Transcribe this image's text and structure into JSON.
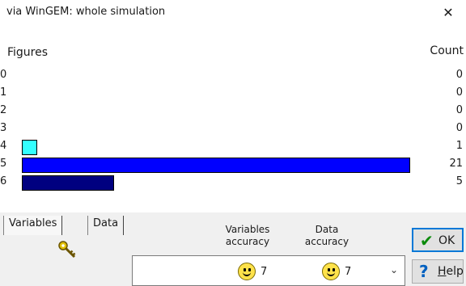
{
  "window": {
    "title": "via WinGEM: whole simulation",
    "close_glyph": "✕"
  },
  "chart_data": {
    "type": "bar",
    "orientation": "horizontal",
    "left_header": "Figures",
    "right_header": "Count",
    "categories": [
      "0",
      "1",
      "2",
      "3",
      "4",
      "5",
      "6"
    ],
    "values": [
      0,
      0,
      0,
      0,
      1,
      21,
      5
    ],
    "bar_colors": [
      "#00ffff",
      "#00ffff",
      "#00ffff",
      "#00ffff",
      "#33ffff",
      "#0000ff",
      "#000080"
    ],
    "xlim": [
      0,
      21
    ]
  },
  "tabs": [
    {
      "label": "Variables",
      "active": true
    },
    {
      "label": "Data",
      "active": false
    }
  ],
  "columns": {
    "variables_accuracy": {
      "line1": "Variables",
      "line2": "accuracy"
    },
    "data_accuracy": {
      "line1": "Data",
      "line2": "accuracy"
    }
  },
  "key_icon": "key-icon",
  "combo": {
    "variables_value": "7",
    "data_value": "7",
    "chevron": "⌄"
  },
  "buttons": {
    "ok": {
      "label": "OK",
      "icon": "✔",
      "icon_color": "#0a8a0a"
    },
    "help": {
      "label_prefix": "H",
      "label_rest": "elp",
      "icon": "?",
      "icon_color": "#0060c0"
    }
  }
}
